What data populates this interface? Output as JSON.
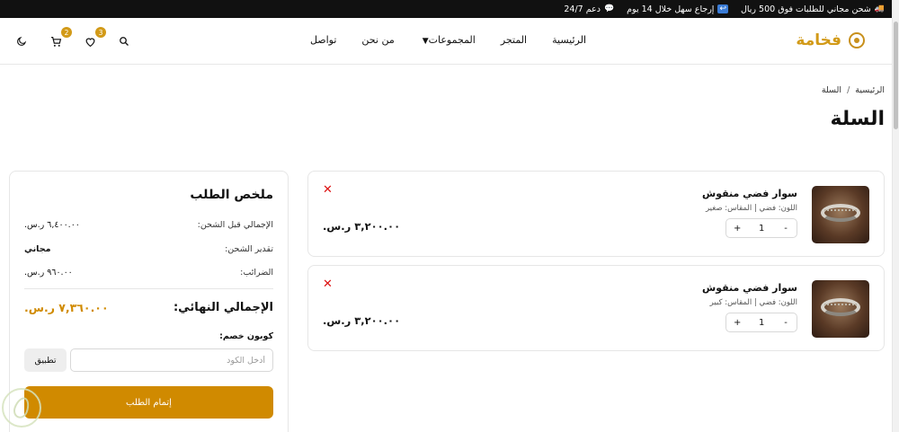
{
  "topbar": {
    "items": [
      {
        "icon": "truck-icon",
        "text": "شحن مجاني للطلبات فوق 500 ريال"
      },
      {
        "icon": "return-icon",
        "text": "إرجاع سهل خلال 14 يوم"
      },
      {
        "icon": "chat-icon",
        "text": "دعم 24/7"
      }
    ]
  },
  "header": {
    "brand": "فخامة",
    "nav": [
      "الرئيسية",
      "المتجر",
      "المجموعات",
      "من نحن",
      "تواصل"
    ],
    "cart_count": "2",
    "wishlist_count": "3"
  },
  "breadcrumb": {
    "home": "الرئيسية",
    "sep": "/",
    "current": "السلة"
  },
  "page_title": "السلة",
  "cart_items": [
    {
      "name": "سوار فضي منقوش",
      "meta": "اللون: فضي | المقاس: صغير",
      "qty": "1",
      "price": "٣,٢٠٠.٠٠ ر.س."
    },
    {
      "name": "سوار فضي منقوش",
      "meta": "اللون: فضي | المقاس: كبير",
      "qty": "1",
      "price": "٣,٢٠٠.٠٠ ر.س."
    }
  ],
  "summary": {
    "title": "ملخص الطلب",
    "subtotal_label": "الإجمالي قبل الشحن:",
    "subtotal_value": "٦,٤٠٠.٠٠ ر.س.",
    "shipping_label": "تقدير الشحن:",
    "shipping_value": "مجاني",
    "tax_label": "الضرائب:",
    "tax_value": "٩٦٠.٠٠ ر.س.",
    "total_label": "الإجمالي النهائي:",
    "total_value": "٧,٣٦٠.٠٠ ر.س.",
    "coupon_label": "كوبون خصم:",
    "coupon_placeholder": "أدخل الكود",
    "apply_label": "تطبيق",
    "checkout_label": "إتمام الطلب"
  },
  "colors": {
    "accent": "#d08a00",
    "brand": "#d29a18",
    "remove": "#dd1111"
  }
}
